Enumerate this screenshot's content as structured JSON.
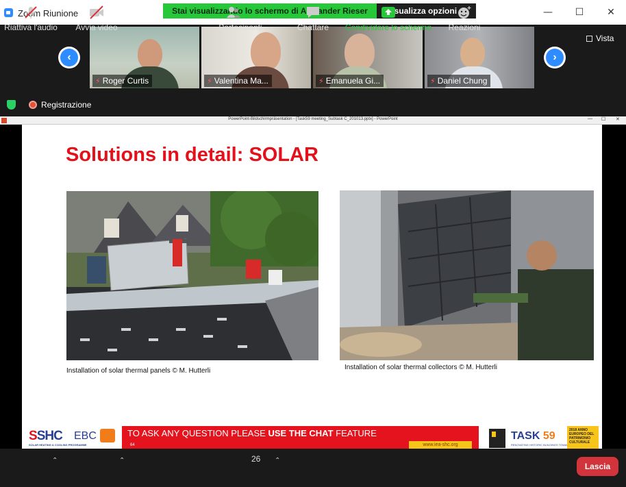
{
  "window": {
    "title": "Zoom Riunione",
    "minimize": "—",
    "maximize": "☐",
    "close": "✕"
  },
  "share_banner": {
    "text": "Stai visualizzando lo schermo di Alexander Rieser",
    "view_options": "Visualizza opzioni ⌄"
  },
  "gallery": {
    "participants": [
      {
        "name": "Roger Curtis"
      },
      {
        "name": "Valentina Ma..."
      },
      {
        "name": "Emanuela Gi..."
      },
      {
        "name": "Daniel Chung"
      }
    ],
    "prev_arrow": "‹",
    "next_arrow": "›",
    "view_label": "Vista"
  },
  "status": {
    "recording": "Registrazione"
  },
  "ppt": {
    "window_title": "PowerPoint-Bildschirmpräsentation - [Task59 meeting_Subtask C_201013.pptx] - PowerPoint",
    "slide_title": "Solutions in detail: SOLAR",
    "caption_left": "Installation of solar thermal panels © M. Hutterli",
    "caption_right": "Installation of solar thermal collectors © M. Hutterli",
    "footer": {
      "shc_logo": "SHC",
      "shc_sub": "SOLAR HEATING & COOLING PROGRAMME",
      "ebc_logo": "EBC",
      "question_prefix": "TO ASK ANY QUESTION PLEASE ",
      "question_bold": "USE THE CHAT",
      "question_suffix": " FEATURE",
      "page_number": "64",
      "url": "www.iea-shc.org",
      "task_label": "TASK",
      "task_number": "59",
      "task_sub": "RENOVATING HISTORIC BUILDINGS TOWARDS ZERO ENERGY",
      "badge": "2018 ANNO EUROPEO DEL PATRIMONIO CULTURALE"
    }
  },
  "toolbar": {
    "unmute": "Riattiva l'audio",
    "start_video": "Avvia video",
    "participants": "Partecipanti",
    "participant_count": "26",
    "chat": "Chattare",
    "share": "Condividere lo schermo",
    "reactions": "Reazioni",
    "leave": "Lascia"
  },
  "colors": {
    "accent": "#2d8cff",
    "banner_green": "#27c73a",
    "leave_red": "#d1343a",
    "share_green": "#27c73a",
    "slide_red": "#e2111b"
  }
}
